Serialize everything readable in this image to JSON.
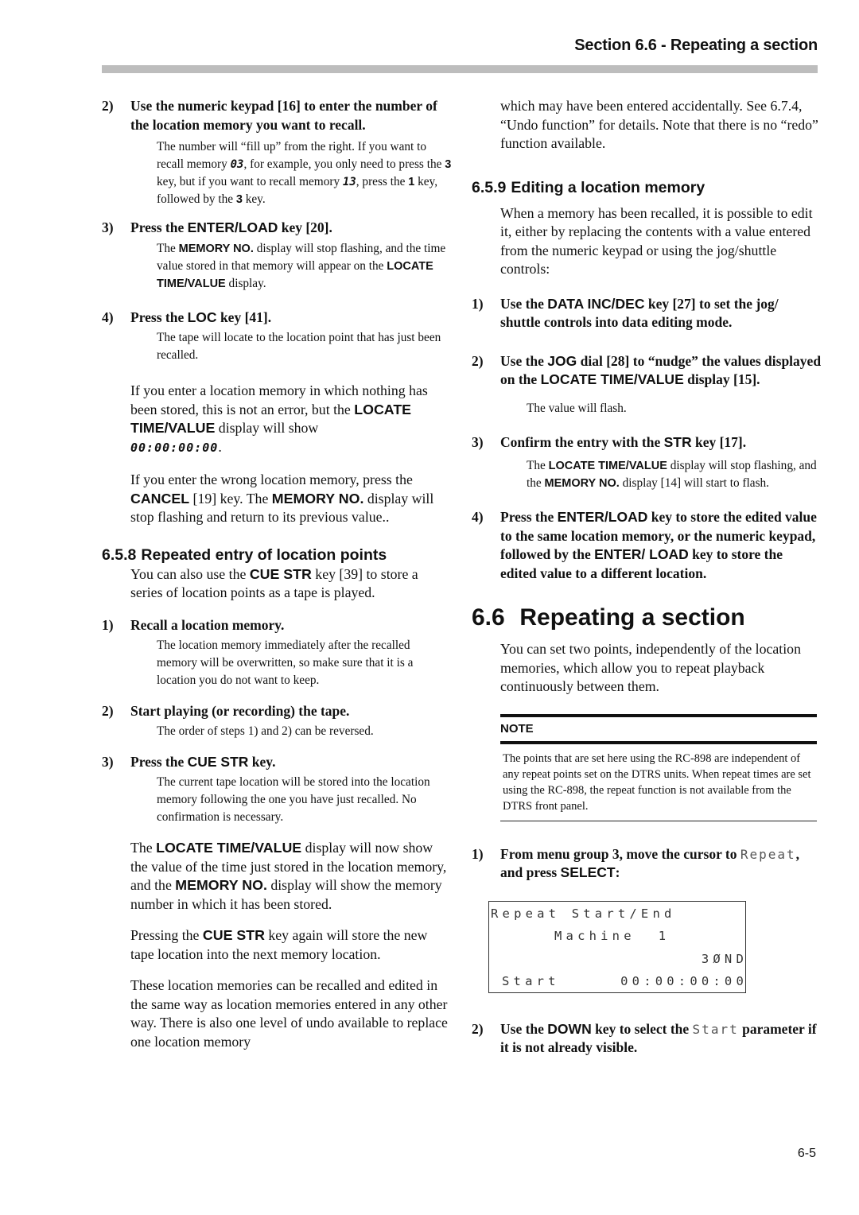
{
  "header": {
    "running_title": "Section 6.6 - Repeating a section"
  },
  "left_column": {
    "step2": {
      "num": "2)",
      "text": "Use the numeric keypad [16] to enter the number of the location memory you want to recall.",
      "desc": {
        "t1": "The number will “fill up” from the right. If you want to recall memory ",
        "code1": "03",
        "t2": ", for example, you only need to press the ",
        "key1": "3",
        "t3": " key, but if you want to recall memory ",
        "code2": "13",
        "t4": ", press the ",
        "key2": "1",
        "t5": " key, followed by the ",
        "key3": "3",
        "t6": " key."
      }
    },
    "step3": {
      "num": "3)",
      "t1": "Press the ",
      "key": "ENTER/LOAD",
      "t2": " key [20].",
      "desc": {
        "t1": "The ",
        "k1": "MEMORY NO.",
        "t2": " display will stop flashing, and the time value stored in that memory will appear on the ",
        "k2": "LOCATE TIME/VALUE",
        "t3": " display."
      }
    },
    "step4": {
      "num": "4)",
      "t1": "Press the ",
      "key": "LOC",
      "t2": " key [41].",
      "desc": "The tape will locate to the location point that has just been recalled."
    },
    "para_empty": {
      "t1": "If you enter a location memory in which nothing has been stored, this is not an error, but the ",
      "k1": "LOCATE TIME/VALUE",
      "t2": " display will show ",
      "code": "00:00:00:00",
      "t3": "."
    },
    "para_wrong": {
      "t1": "If you enter the wrong location memory, press the ",
      "k1": "CANCEL",
      "t2": " [19] key. The ",
      "k2": "MEMORY NO.",
      "t3": " display will stop flashing and return to its previous value.."
    },
    "section_658": {
      "number": "6.5.8",
      "title": "Repeated entry of location points",
      "intro_t1": "You can also use the ",
      "intro_k1": "CUE STR",
      "intro_t2": " key [39] to store a series of location points as a tape is played."
    },
    "s658_step1": {
      "num": "1)",
      "text": "Recall a location memory.",
      "desc": "The location memory immediately after the recalled memory will be overwritten, so make sure that it is a location you do not want to keep."
    },
    "s658_step2": {
      "num": "2)",
      "text": "Start playing (or recording) the tape.",
      "desc": "The order of steps 1) and 2) can be reversed."
    },
    "s658_step3": {
      "num": "3)",
      "t1": "Press the ",
      "key": "CUE STR",
      "t2": " key.",
      "desc": "The current tape location will be stored into the location memory following the one you have just recalled. No confirmation is necessary."
    },
    "para_now": {
      "t1": "The ",
      "k1": "LOCATE TIME/VALUE",
      "t2": " display will now show the value of the time just stored in the location memory, and the ",
      "k2": "MEMORY NO.",
      "t3": " display will show the memory number in which it has been stored."
    },
    "para_again": {
      "t1": "Pressing the ",
      "k1": "CUE STR",
      "t2": " key again will store the new tape location into the next memory location."
    },
    "para_recall": "These location memories can be recalled and edited in the same way as location memories entered in any other way. There is also one level of undo available to replace one location memory"
  },
  "right_column": {
    "para_cont": "which may have been entered accidentally. See 6.7.4, “Undo function” for details. Note that there is no “redo” function available.",
    "section_659": {
      "number": "6.5.9",
      "title": "Editing a location memory",
      "intro": "When a memory has been recalled, it is possible to edit it, either by replacing the contents with a value entered from the numeric keypad or using the jog/shuttle controls:"
    },
    "s659_step1": {
      "num": "1)",
      "t1": "Use the ",
      "key": "DATA INC/DEC",
      "t2": " key [27] to set the jog/ shuttle controls into data editing mode."
    },
    "s659_step2": {
      "num": "2)",
      "t1": "Use the ",
      "k1": "JOG",
      "t2": " dial [28] to “nudge” the values displayed on the ",
      "k2": "LOCATE TIME/VALUE",
      "t3": " display [15].",
      "desc": "The value will flash."
    },
    "s659_step3": {
      "num": "3)",
      "t1": "Confirm the entry with the ",
      "key": "STR",
      "t2": " key [17].",
      "desc": {
        "t1": "The ",
        "k1": "LOCATE TIME/VALUE",
        "t2": " display will stop flashing, and the ",
        "k2": "MEMORY NO.",
        "t3": " display [14] will start to flash."
      }
    },
    "s659_step4": {
      "num": "4)",
      "t1": "Press the ",
      "k1": "ENTER/LOAD",
      "t2": " key to store the edited value to the same location memory, or the numeric keypad, followed by the ",
      "k2": "ENTER/ LOAD",
      "t3": " key to store the edited value to a different location."
    },
    "section_66": {
      "number": "6.6",
      "title": "Repeating a section",
      "intro": "You can set two points, independently of the location memories, which allow you to repeat playback continuously between them."
    },
    "note": {
      "label": "NOTE",
      "body": "The points that are set here using the RC-898 are independent of any repeat points set on the DTRS units. When repeat times are set using the RC-898, the repeat function is not available from the DTRS front panel."
    },
    "s66_step1": {
      "num": "1)",
      "t1": "From menu group 3, move the cursor to ",
      "lcd_word": "Repeat",
      "t2": ", and press ",
      "key": "SELECT",
      "t3": ":"
    },
    "lcd_display": {
      "line1": "Repeat Start/End",
      "line2": "Machine  1",
      "line3": "3ØND",
      "line4_label": "Start",
      "line4_value": "00:00:00:00"
    },
    "s66_step2": {
      "num": "2)",
      "t1": "Use the ",
      "key": "DOWN",
      "t2": " key to select the ",
      "lcd_word": "Start",
      "t3": " parameter if it is not already visible."
    }
  },
  "footer": {
    "page_number": "6-5"
  }
}
